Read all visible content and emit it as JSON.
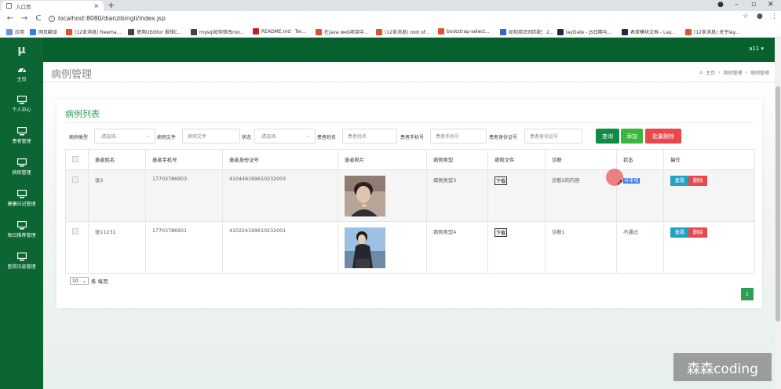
{
  "browser": {
    "tab_title": "入口页",
    "tab_close": "×",
    "new_tab": "+",
    "url": "localhost:8080/dianzibingli/index.jsp",
    "bookmarks": [
      {
        "label": "应用",
        "color": "#6c8fd6"
      },
      {
        "label": "网页翻译",
        "color": "#2f80ed"
      },
      {
        "label": "(12条消息) freema...",
        "color": "#e2512f"
      },
      {
        "label": "使用UEditor 报错C...",
        "color": "#444444"
      },
      {
        "label": "mysql如何修改roo...",
        "color": "#444444"
      },
      {
        "label": "README.md · Ter...",
        "color": "#c71d23"
      },
      {
        "label": "在java web项目中...",
        "color": "#e2512f"
      },
      {
        "label": "(12条消息) root of...",
        "color": "#e2512f"
      },
      {
        "label": "bootstrap-select...",
        "color": "#e2512f"
      },
      {
        "label": "如何用正则匹配：2...",
        "color": "#3b63c4"
      },
      {
        "label": "layDate - JS日期与...",
        "color": "#1e2a4a"
      },
      {
        "label": "表单模块文档 - Lay...",
        "color": "#1e2a4a"
      },
      {
        "label": "(12条消息) 关于lay...",
        "color": "#e2512f"
      }
    ]
  },
  "sidebar": {
    "logo": "μ",
    "items": [
      {
        "label": "主页",
        "icon": "dashboard-icon"
      },
      {
        "label": "个人中心",
        "icon": "monitor-icon"
      },
      {
        "label": "患者管理",
        "icon": "monitor-icon"
      },
      {
        "label": "病例管理",
        "icon": "monitor-icon"
      },
      {
        "label": "健康日记管理",
        "icon": "monitor-icon"
      },
      {
        "label": "每日推荐管理",
        "icon": "monitor-icon"
      },
      {
        "label": "医院讯息管理",
        "icon": "monitor-icon"
      }
    ]
  },
  "topbar": {
    "user": "a11 ▾"
  },
  "header": {
    "title": "病例管理",
    "breadcrumbs": [
      "主页",
      "病例管理",
      "病例管理"
    ]
  },
  "panel": {
    "title": "病例列表",
    "filters": {
      "type_label": "病例类型",
      "type_select": "-请选择-",
      "file_label": "病例文件",
      "file_placeholder": "病例文件",
      "status_label": "状态",
      "status_select": "-请选择-",
      "name_label": "患者姓名",
      "name_placeholder": "患者姓名",
      "phone_label": "患者手机号",
      "phone_placeholder": "患者手机号",
      "id_label": "患者身份证号",
      "id_placeholder": "患者身份证号"
    },
    "buttons": {
      "search": "查询",
      "add": "添加",
      "batch_delete": "批量删除"
    },
    "columns": [
      "患者姓名",
      "患者手机号",
      "患者身份证号",
      "患者照片",
      "病例类型",
      "病例文件",
      "诊断",
      "状态",
      "操作"
    ],
    "rows": [
      {
        "name": "张3",
        "phone": "17703786903",
        "id_card": "410449199610232003",
        "type": "病例类型3",
        "file": "下载",
        "diagnosis": "诊断2的内容",
        "status": "待审核",
        "view": "查看",
        "delete": "删除"
      },
      {
        "name": "张11231",
        "phone": "17703786901",
        "id_card": "410224199610232001",
        "type": "病例类型4",
        "file": "下载",
        "diagnosis": "诊断1",
        "status": "不通过",
        "view": "查看",
        "delete": "删除"
      }
    ],
    "pager": {
      "page_size": "10",
      "per_page_label": "条 每页",
      "current_page": "1"
    }
  },
  "watermark": "森森coding",
  "colors": {
    "sidebar": "#0b6633",
    "topbar": "#07612f",
    "accent": "#2d9f57",
    "search_btn": "#0d8b47",
    "add_btn": "#3bb53b",
    "delete_btn": "#e9474b",
    "view_btn": "#1fa2c4"
  }
}
